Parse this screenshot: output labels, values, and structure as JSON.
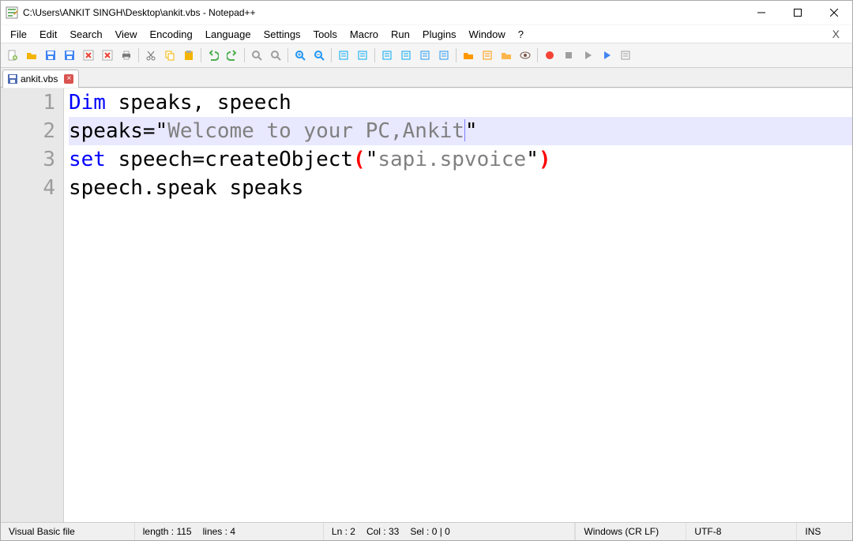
{
  "window": {
    "title": "C:\\Users\\ANKIT SINGH\\Desktop\\ankit.vbs - Notepad++"
  },
  "menu": {
    "items": [
      "File",
      "Edit",
      "Search",
      "View",
      "Encoding",
      "Language",
      "Settings",
      "Tools",
      "Macro",
      "Run",
      "Plugins",
      "Window",
      "?"
    ]
  },
  "tab": {
    "filename": "ankit.vbs"
  },
  "code": {
    "lines": {
      "l1": {
        "n": "1",
        "kw": "Dim",
        "rest": " speaks, speech"
      },
      "l2": {
        "n": "2",
        "pre": "speaks=",
        "q1": "\"",
        "str": "Welcome to your PC,Ankit",
        "q2": "\""
      },
      "l3": {
        "n": "3",
        "kw": "set",
        "mid": " speech=createObject",
        "p1": "(",
        "q1": "\"",
        "str": "sapi.spvoice",
        "q2": "\"",
        "p2": ")"
      },
      "l4": {
        "n": "4",
        "txt": "speech.speak speaks"
      }
    }
  },
  "status": {
    "filetype": "Visual Basic file",
    "length_lbl": "length :",
    "length_val": "115",
    "lines_lbl": "lines :",
    "lines_val": "4",
    "ln_lbl": "Ln :",
    "ln_val": "2",
    "col_lbl": "Col :",
    "col_val": "33",
    "sel_lbl": "Sel :",
    "sel_val": "0 | 0",
    "eol": "Windows (CR LF)",
    "enc": "UTF-8",
    "ins": "INS"
  },
  "toolbar_icons": [
    "new",
    "open",
    "save",
    "save-all",
    "close",
    "close-all",
    "print",
    "sep",
    "cut",
    "copy",
    "paste",
    "sep",
    "undo",
    "redo",
    "sep",
    "find",
    "replace",
    "sep",
    "zoom-in",
    "zoom-out",
    "sep",
    "sync-v",
    "sync-h",
    "sep",
    "wrap",
    "all-chars",
    "indent",
    "outdent",
    "sep",
    "folder",
    "doc",
    "folder-open",
    "eye",
    "sep",
    "record",
    "stop",
    "play",
    "play-multi",
    "macro-save"
  ],
  "icon_colors": {
    "new": "#7cb342",
    "open": "#f4b400",
    "save": "#4285f4",
    "save-all": "#4285f4",
    "close": "#ea4335",
    "close-all": "#ea4335",
    "print": "#757575",
    "cut": "#757575",
    "copy": "#f4b400",
    "paste": "#f4b400",
    "undo": "#4caf50",
    "redo": "#4caf50",
    "find": "#9e9e9e",
    "replace": "#9e9e9e",
    "zoom-in": "#2196f3",
    "zoom-out": "#2196f3",
    "sync-v": "#03a9f4",
    "sync-h": "#03a9f4",
    "wrap": "#03a9f4",
    "all-chars": "#03a9f4",
    "indent": "#2196f3",
    "outdent": "#2196f3",
    "folder": "#ff9800",
    "doc": "#ff9800",
    "folder-open": "#ffb74d",
    "eye": "#795548",
    "record": "#f44336",
    "stop": "#9e9e9e",
    "play": "#9e9e9e",
    "play-multi": "#4285f4",
    "macro-save": "#9e9e9e"
  }
}
